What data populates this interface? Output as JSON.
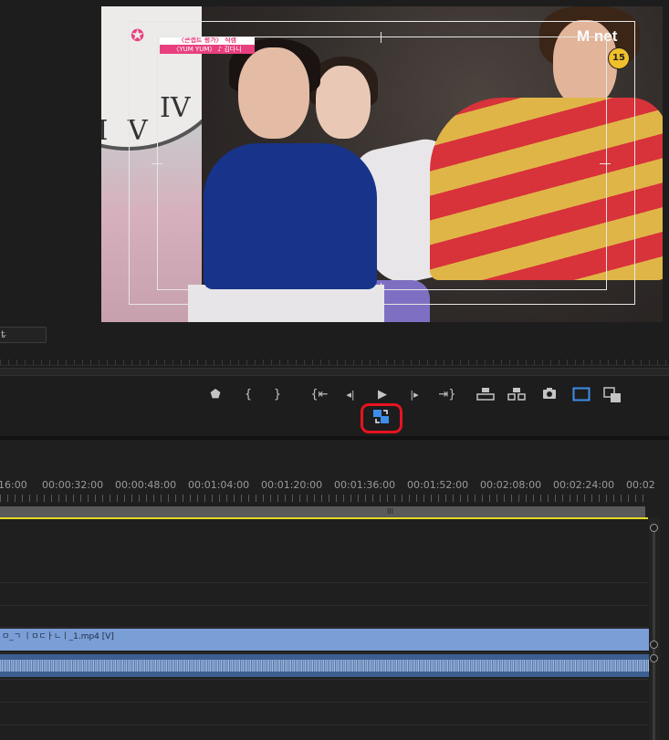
{
  "program_monitor": {
    "overlay_banner_line1": "〈콘셉트 평가〉 직캠",
    "overlay_banner_line2": "〈YUM YUM〉 ♪ 김다니",
    "overlay_logo": "PRODUCE 101",
    "overlay_channel": "Mnet",
    "overlay_rating": "15",
    "fit_dropdown_value": "t",
    "clock_numerals": [
      "IV",
      "V",
      "VI"
    ]
  },
  "transport": {
    "buttons": [
      {
        "name": "add-marker-icon",
        "glyph": "⬟"
      },
      {
        "name": "mark-in-icon",
        "glyph": "{"
      },
      {
        "name": "mark-out-icon",
        "glyph": "}"
      },
      {
        "name": "go-to-in-icon",
        "glyph": "{⇤"
      },
      {
        "name": "step-back-icon",
        "glyph": "◀|"
      },
      {
        "name": "play-icon",
        "glyph": "▶"
      },
      {
        "name": "step-forward-icon",
        "glyph": "|▶"
      },
      {
        "name": "go-to-out-icon",
        "glyph": "⇥}"
      },
      {
        "name": "lift-icon",
        "glyph": "⏏"
      },
      {
        "name": "extract-icon",
        "glyph": "⎍"
      },
      {
        "name": "export-frame-icon",
        "glyph": "📷"
      },
      {
        "name": "safe-margins-icon",
        "glyph": "▢"
      },
      {
        "name": "comparison-view-icon",
        "glyph": "⧉"
      }
    ],
    "toggle_proxies": "toggle-proxies-icon",
    "highlight_color": "#e8141f",
    "active_color": "#3d8eea"
  },
  "timeline": {
    "timecodes": [
      "16:00",
      "00:00:32:00",
      "00:00:48:00",
      "00:01:04:00",
      "00:01:20:00",
      "00:01:36:00",
      "00:01:52:00",
      "00:02:08:00",
      "00:02:24:00",
      "00:02"
    ],
    "video_clip_label": "ㅁ_ㄱ ㅣㅁㄷㅏㄴㅣ_1.mp4 [V]",
    "work_area_grip": "III",
    "video_clip_color": "#7a9fd6",
    "audio_clip_color": "#3c5e90",
    "in_out_color": "#e5dc22"
  }
}
